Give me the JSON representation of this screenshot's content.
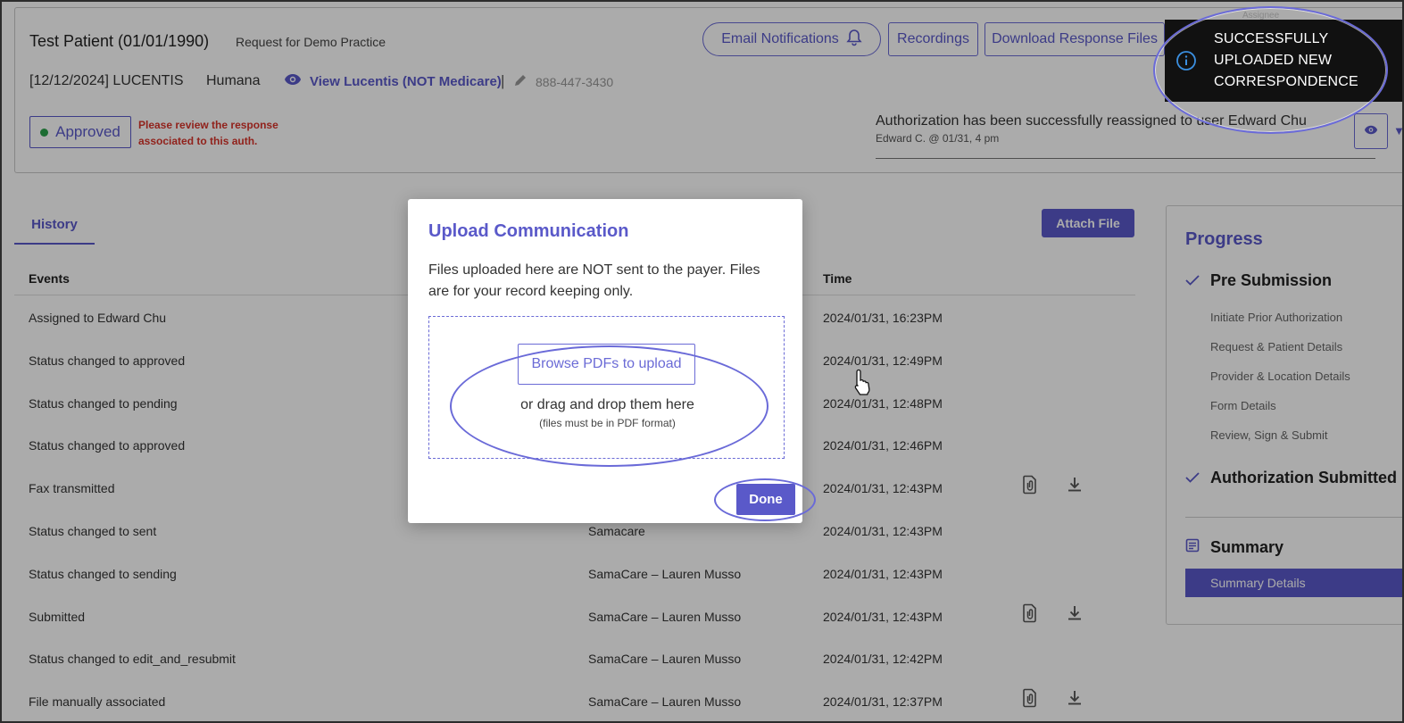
{
  "header": {
    "patient": "Test Patient (01/01/1990)",
    "practice": "Request for Demo Practice",
    "drug": "[12/12/2024] LUCENTIS",
    "payer": "Humana",
    "view_link": "View Lucentis (NOT Medicare)",
    "separator": "|",
    "phone": "888-447-3430",
    "buttons": {
      "email": "Email Notifications",
      "recordings": "Recordings",
      "download": "Download Response Files"
    },
    "status": "Approved",
    "status_color": "#2ca24b",
    "review_msg": "Please review the response associated to this auth.",
    "auth_msg": "Authorization has been successfully reassigned to user Edward Chu",
    "auth_sub": "Edward C. @ 01/31, 4 pm"
  },
  "tabs": {
    "history": "History"
  },
  "attach_file": "Attach File",
  "table": {
    "headers": {
      "events": "Events",
      "time": "Time"
    },
    "rows": [
      {
        "event": "Assigned to Edward Chu",
        "by": "",
        "time": "2024/01/31, 16:23PM",
        "icons": false
      },
      {
        "event": "Status changed to approved",
        "by": "",
        "time": "2024/01/31, 12:49PM",
        "icons": false
      },
      {
        "event": "Status changed to pending",
        "by": "",
        "time": "2024/01/31, 12:48PM",
        "icons": false
      },
      {
        "event": "Status changed to approved",
        "by": "",
        "time": "2024/01/31, 12:46PM",
        "icons": false
      },
      {
        "event": "Fax transmitted",
        "by": "",
        "time": "2024/01/31, 12:43PM",
        "icons": true
      },
      {
        "event": "Status changed to sent",
        "by": "Samacare",
        "time": "2024/01/31, 12:43PM",
        "icons": false
      },
      {
        "event": "Status changed to sending",
        "by": "SamaCare – Lauren Musso",
        "time": "2024/01/31, 12:43PM",
        "icons": false
      },
      {
        "event": "Submitted",
        "by": "SamaCare – Lauren Musso",
        "time": "2024/01/31, 12:43PM",
        "icons": true
      },
      {
        "event": "Status changed to edit_and_resubmit",
        "by": "SamaCare – Lauren Musso",
        "time": "2024/01/31, 12:42PM",
        "icons": false
      },
      {
        "event": "File manually associated",
        "by": "SamaCare – Lauren Musso",
        "time": "2024/01/31, 12:37PM",
        "icons": true
      }
    ]
  },
  "progress": {
    "title": "Progress",
    "pre_submission": "Pre Submission",
    "steps": [
      "Initiate Prior Authorization",
      "Request & Patient Details",
      "Provider & Location Details",
      "Form Details",
      "Review, Sign & Submit"
    ],
    "submitted": "Authorization Submitted",
    "summary": "Summary",
    "summary_details": "Summary Details"
  },
  "toast": {
    "message": "SUCCESSFULLY UPLOADED NEW CORRESPONDENCE",
    "partial_label": "Assignee"
  },
  "modal": {
    "title": "Upload Communication",
    "note": "Files uploaded here are NOT sent to the payer. Files are for your record keeping only.",
    "browse": "Browse PDFs to upload",
    "drag": "or drag and drop them here",
    "pdf_note": "(files must be in PDF format)",
    "done": "Done"
  },
  "colors": {
    "accent": "#5a59c9",
    "alert": "#d9342b",
    "annotation": "#6a6ad8"
  }
}
